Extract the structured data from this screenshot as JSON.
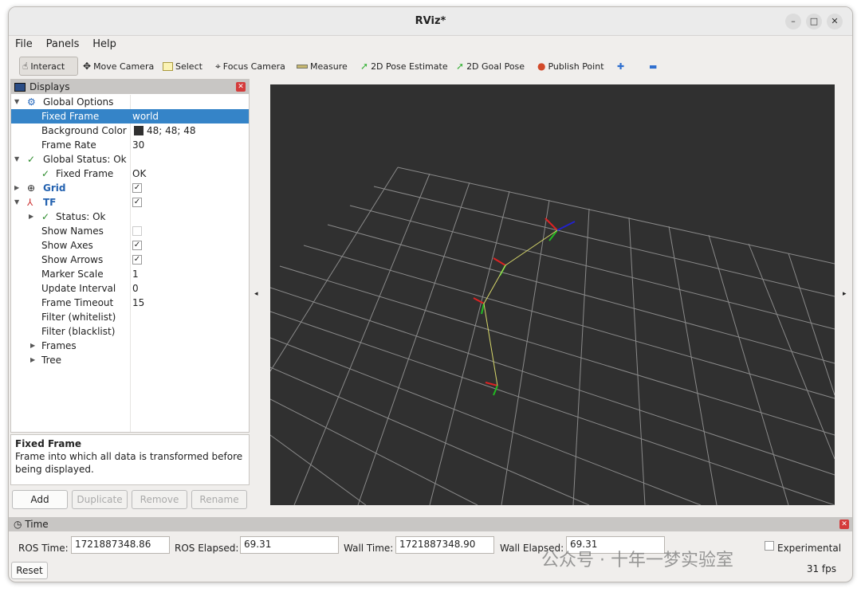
{
  "window": {
    "title": "RViz*"
  },
  "menu": [
    "File",
    "Panels",
    "Help"
  ],
  "toolbar": [
    {
      "label": "Interact"
    },
    {
      "label": "Move Camera"
    },
    {
      "label": "Select"
    },
    {
      "label": "Focus Camera"
    },
    {
      "label": "Measure"
    },
    {
      "label": "2D Pose Estimate"
    },
    {
      "label": "2D Goal Pose"
    },
    {
      "label": "Publish Point"
    }
  ],
  "displays": {
    "title": "Displays",
    "rows": [
      {
        "k": "Global Options",
        "v": ""
      },
      {
        "k": "Fixed Frame",
        "v": "world"
      },
      {
        "k": "Background Color",
        "v": "48; 48; 48"
      },
      {
        "k": "Frame Rate",
        "v": "30"
      },
      {
        "k": "Global Status: Ok",
        "v": ""
      },
      {
        "k": "Fixed Frame",
        "v": "OK"
      },
      {
        "k": "Grid",
        "v": ""
      },
      {
        "k": "TF",
        "v": ""
      },
      {
        "k": "Status: Ok",
        "v": ""
      },
      {
        "k": "Show Names",
        "v": ""
      },
      {
        "k": "Show Axes",
        "v": ""
      },
      {
        "k": "Show Arrows",
        "v": ""
      },
      {
        "k": "Marker Scale",
        "v": "1"
      },
      {
        "k": "Update Interval",
        "v": "0"
      },
      {
        "k": "Frame Timeout",
        "v": "15"
      },
      {
        "k": "Filter (whitelist)",
        "v": ""
      },
      {
        "k": "Filter (blacklist)",
        "v": ""
      },
      {
        "k": "Frames",
        "v": ""
      },
      {
        "k": "Tree",
        "v": ""
      }
    ]
  },
  "description": {
    "title": "Fixed Frame",
    "text": "Frame into which all data is transformed before being displayed."
  },
  "buttons": {
    "add": "Add",
    "duplicate": "Duplicate",
    "remove": "Remove",
    "rename": "Rename"
  },
  "time": {
    "title": "Time",
    "ros_time_label": "ROS Time:",
    "ros_time": "1721887348.86",
    "ros_elapsed_label": "ROS Elapsed:",
    "ros_elapsed": "69.31",
    "wall_time_label": "Wall Time:",
    "wall_time": "1721887348.90",
    "wall_elapsed_label": "Wall Elapsed:",
    "wall_elapsed": "69.31",
    "experimental": "Experimental",
    "reset": "Reset",
    "fps": "31 fps"
  },
  "watermark": "公众号 · 十年一梦实验室",
  "colors": {
    "viewport_bg": "#303030",
    "selection": "#3584c8"
  }
}
